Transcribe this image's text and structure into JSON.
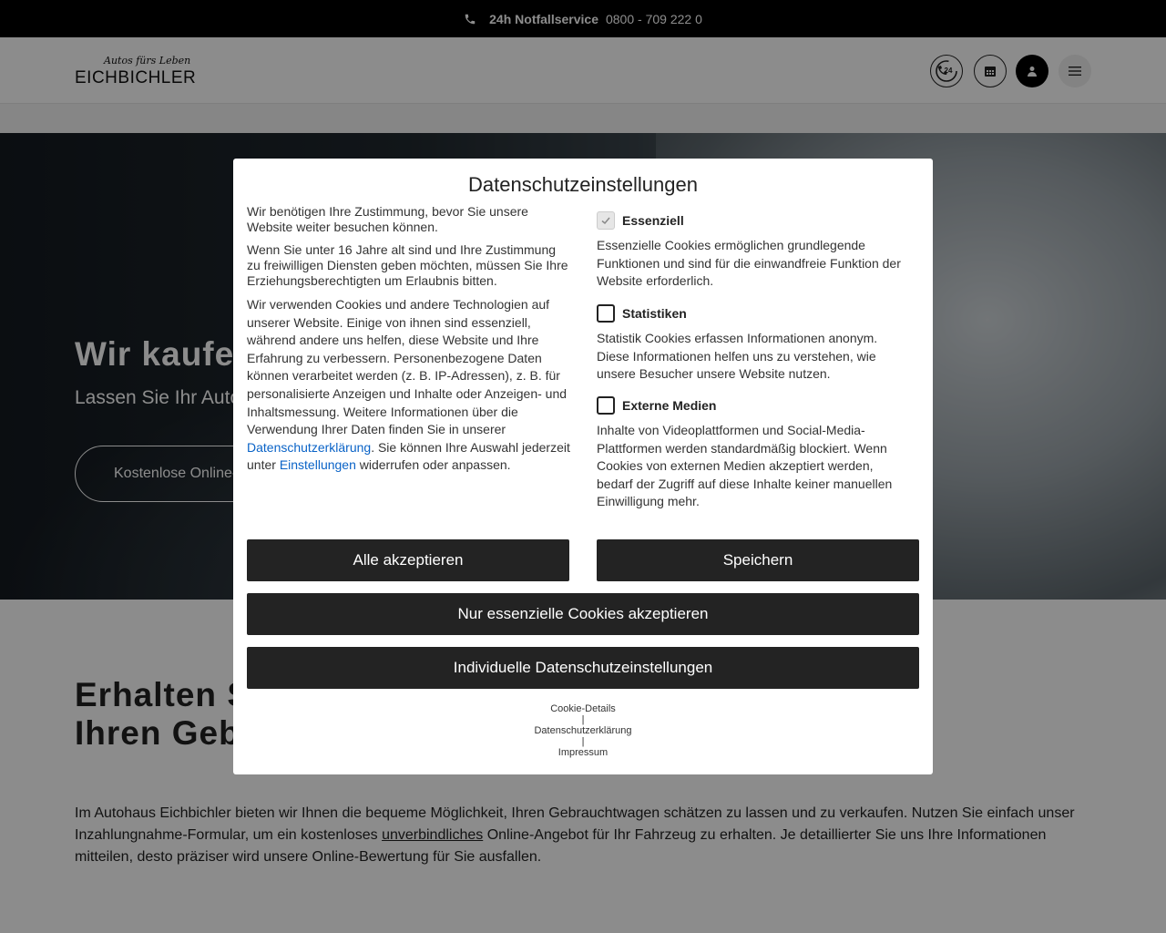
{
  "topbar": {
    "label": "24h Notfallservice",
    "phone": "0800 - 709 222 0"
  },
  "header": {
    "logo_script": "Autos fürs Leben",
    "logo_word": "EICHBICHLER",
    "badge_24": "24"
  },
  "hero": {
    "title": "Wir kaufen Ihr Auto",
    "subtitle": "Lassen Sie Ihr Auto bewerten",
    "cta": "Kostenlose Online-Bewertung"
  },
  "content": {
    "title": "Erhalten Sie ein kostenloses Angebot für Ihren Gebrauchtwagen online",
    "text_1": "Im Autohaus Eichbichler bieten wir Ihnen die bequeme Möglichkeit, Ihren Gebrauchtwagen schätzen zu lassen und zu verkaufen. Nutzen Sie einfach unser Inzahlungnahme-Formular, um ein kostenloses ",
    "text_link": "unverbindliches",
    "text_2": " Online-Angebot für Ihr Fahrzeug zu erhalten. Je detaillierter Sie uns Ihre Informationen mitteilen, desto präziser wird unsere Online-Bewertung für Sie ausfallen."
  },
  "modal": {
    "title": "Datenschutzeinstellungen",
    "p1": "Wir benötigen Ihre Zustimmung, bevor Sie unsere Website weiter besuchen können.",
    "p2": "Wenn Sie unter 16 Jahre alt sind und Ihre Zustimmung zu freiwilligen Diensten geben möchten, müssen Sie Ihre Erziehungsberechtigten um Erlaubnis bitten.",
    "p3_a": "Wir verwenden Cookies und andere Technologien auf unserer Website. Einige von ihnen sind essenziell, während andere uns helfen, diese Website und Ihre Erfahrung zu verbessern. Personenbezogene Daten können verarbeitet werden (z. B. IP-Adressen), z. B. für personalisierte Anzeigen und Inhalte oder Anzeigen- und Inhaltsmessung. Weitere Informationen über die Verwendung Ihrer Daten finden Sie in unserer ",
    "p3_link1": "Datenschutzerklärung",
    "p3_b": ". Sie können Ihre Auswahl jederzeit unter ",
    "p3_link2": "Einstellungen",
    "p3_c": " widerrufen oder anpassen.",
    "options": [
      {
        "name": "Essenziell",
        "checked": true,
        "desc": "Essenzielle Cookies ermöglichen grundlegende Funktionen und sind für die einwandfreie Funktion der Website erforderlich."
      },
      {
        "name": "Statistiken",
        "checked": false,
        "desc": "Statistik Cookies erfassen Informationen anonym. Diese Informationen helfen uns zu verstehen, wie unsere Besucher unsere Website nutzen."
      },
      {
        "name": "Externe Medien",
        "checked": false,
        "desc": "Inhalte von Videoplattformen und Social-Media-Plattformen werden standardmäßig blockiert. Wenn Cookies von externen Medien akzeptiert werden, bedarf der Zugriff auf diese Inhalte keiner manuellen Einwilligung mehr."
      }
    ],
    "btn_accept_all": "Alle akzeptieren",
    "btn_save": "Speichern",
    "btn_essential": "Nur essenzielle Cookies akzeptieren",
    "btn_individual": "Individuelle Datenschutzeinstellungen",
    "links": {
      "cookie_details": "Cookie-Details",
      "sep": "|",
      "privacy": "Datenschutzerklärung",
      "imprint": "Impressum"
    }
  }
}
